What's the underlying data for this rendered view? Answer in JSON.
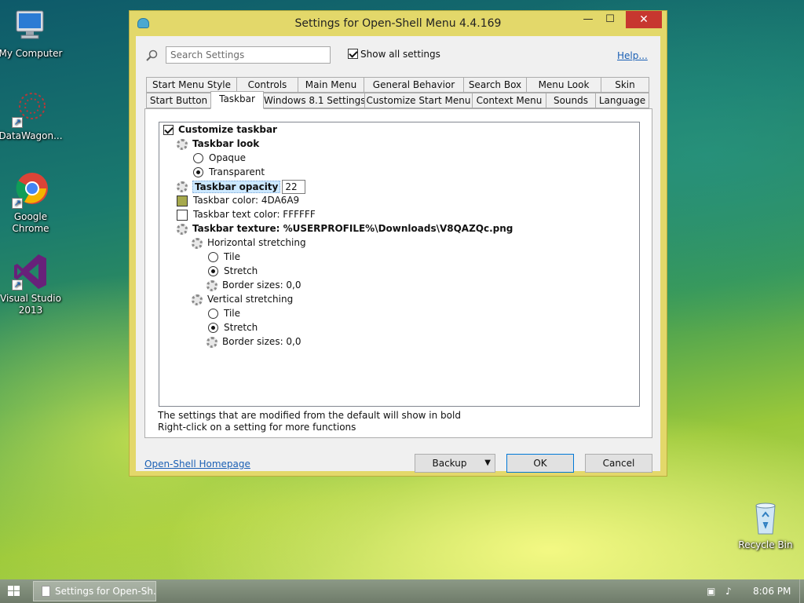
{
  "desktop": {
    "icons": [
      {
        "label": "My Computer"
      },
      {
        "label": "DataWagon..."
      },
      {
        "label": "Google Chrome"
      },
      {
        "label": "Visual Studio 2013"
      },
      {
        "label": "Recycle Bin"
      }
    ]
  },
  "window": {
    "title": "Settings for Open-Shell Menu 4.4.169",
    "minimize_glyph": "—",
    "maximize_glyph": "☐",
    "close_glyph": "✕"
  },
  "toolbar": {
    "search_placeholder": "Search Settings",
    "show_all_label": "Show all settings",
    "show_all_checked": true,
    "help_label": "Help..."
  },
  "tabs": {
    "row1": [
      "Start Menu Style",
      "Controls",
      "Main Menu",
      "General Behavior",
      "Search Box",
      "Menu Look",
      "Skin"
    ],
    "row2": [
      "Start Button",
      "Taskbar",
      "Windows 8.1 Settings",
      "Customize Start Menu",
      "Context Menu",
      "Sounds",
      "Language"
    ],
    "active": "Taskbar"
  },
  "tree": {
    "customize_taskbar": "Customize taskbar",
    "taskbar_look": "Taskbar look",
    "opaque": "Opaque",
    "transparent": "Transparent",
    "taskbar_opacity": "Taskbar opacity",
    "taskbar_opacity_value": "22",
    "taskbar_color": "Taskbar color: 4DA6A9",
    "taskbar_color_swatch": "#A6A94D",
    "taskbar_text_color": "Taskbar text color: FFFFFF",
    "taskbar_text_swatch": "#FFFFFF",
    "taskbar_texture": "Taskbar texture: %USERPROFILE%\\Downloads\\V8QAZQc.png",
    "horizontal_stretching": "Horizontal stretching",
    "h_tile": "Tile",
    "h_stretch": "Stretch",
    "h_border": "Border sizes: 0,0",
    "vertical_stretching": "Vertical stretching",
    "v_tile": "Tile",
    "v_stretch": "Stretch",
    "v_border": "Border sizes: 0,0"
  },
  "info": {
    "line1": "The settings that are modified from the default will show in bold",
    "line2": "Right-click on a setting for more functions"
  },
  "footer": {
    "homepage_label": "Open-Shell Homepage",
    "backup_label": "Backup",
    "ok_label": "OK",
    "cancel_label": "Cancel"
  },
  "taskbar": {
    "task_label": "Settings for Open-Sh...",
    "clock": "8:06 PM"
  },
  "colors": {
    "window_frame": "#E3D86A",
    "close_button": "#C7372F",
    "link": "#1A5FB4",
    "selection": "#CCE8FF"
  }
}
